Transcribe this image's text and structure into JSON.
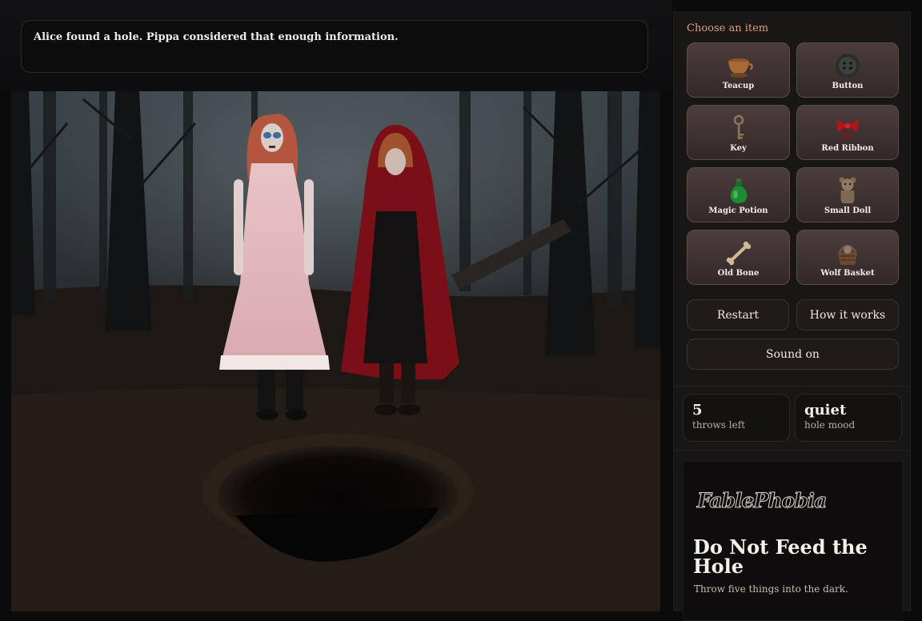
{
  "narration": "Alice found a hole. Pippa considered that enough information.",
  "items_heading": "Choose an item",
  "items": [
    {
      "label": "Teacup",
      "icon": "teacup-icon"
    },
    {
      "label": "Button",
      "icon": "button-icon"
    },
    {
      "label": "Key",
      "icon": "key-icon"
    },
    {
      "label": "Red Ribbon",
      "icon": "red-ribbon-icon"
    },
    {
      "label": "Magic Potion",
      "icon": "magic-potion-icon"
    },
    {
      "label": "Small Doll",
      "icon": "small-doll-icon"
    },
    {
      "label": "Old Bone",
      "icon": "old-bone-icon"
    },
    {
      "label": "Wolf Basket",
      "icon": "wolf-basket-icon"
    }
  ],
  "controls": {
    "restart": "Restart",
    "how_it_works": "How it works",
    "sound": "Sound on"
  },
  "stats": {
    "throws_value": "5",
    "throws_label": "throws left",
    "mood_value": "quiet",
    "mood_label": "hole mood"
  },
  "brand": {
    "logo": "FablePhobia",
    "title": "Do Not Feed the Hole",
    "tagline": "Throw five things into the dark."
  },
  "colors": {
    "accent": "#d6a27c",
    "panel": "#191616",
    "item_button": "#3f3332",
    "background": "#0b0b0c"
  }
}
